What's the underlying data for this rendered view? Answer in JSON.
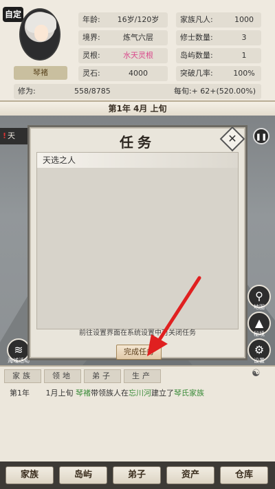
{
  "header": {
    "auto_badge": "自定",
    "character_name": "琴褚",
    "stats_left": [
      {
        "label": "年龄:",
        "value": "16岁/120岁"
      },
      {
        "label": "境界:",
        "value": "炼气六层"
      },
      {
        "label": "灵根:",
        "value": "水天灵根"
      },
      {
        "label": "灵石:",
        "value": "4000"
      }
    ],
    "stats_right": [
      {
        "label": "家族凡人:",
        "value": "1000"
      },
      {
        "label": "修士数量:",
        "value": "3"
      },
      {
        "label": "岛屿数量:",
        "value": "1"
      },
      {
        "label": "突破几率:",
        "value": "100%"
      }
    ],
    "cultivation": {
      "label": "修为:",
      "value": "558/8785",
      "rate": "每旬:+ 62+(520.00%)"
    },
    "date": "第1年 4月 上旬"
  },
  "scene": {
    "alert_text": "天",
    "alert_icon": "warning-icon",
    "pause_icon": "pause-icon",
    "side_buttons": [
      {
        "name": "map-pin-icon",
        "label": "地图"
      },
      {
        "name": "mountain-icon",
        "label": "秘境"
      },
      {
        "name": "gear-icon",
        "label": "设置"
      }
    ],
    "left_button": {
      "name": "sea-icon",
      "label": "海域活动"
    }
  },
  "modal": {
    "title": "任务",
    "tasks": [
      "天选之人"
    ],
    "hint": "前往设置界面在系统设置中可关闭任务",
    "complete_label": "完成任务",
    "close_icon": "close-icon"
  },
  "log": {
    "tabs": [
      "家族",
      "领地",
      "弟子",
      "生产"
    ],
    "entries": [
      {
        "year": "第1年",
        "date": "1月上旬",
        "actor": "琴褚",
        "text1": "带领族人在",
        "place": "忘川河",
        "text2": "建立了",
        "clan": "琴氏家族"
      }
    ]
  },
  "nav": {
    "items": [
      "家族",
      "岛屿",
      "弟子",
      "资产",
      "仓库"
    ]
  },
  "colors": {
    "accent_pink": "#d94a8c",
    "log_green": "#3b8c3a",
    "arrow_red": "#e02020"
  }
}
